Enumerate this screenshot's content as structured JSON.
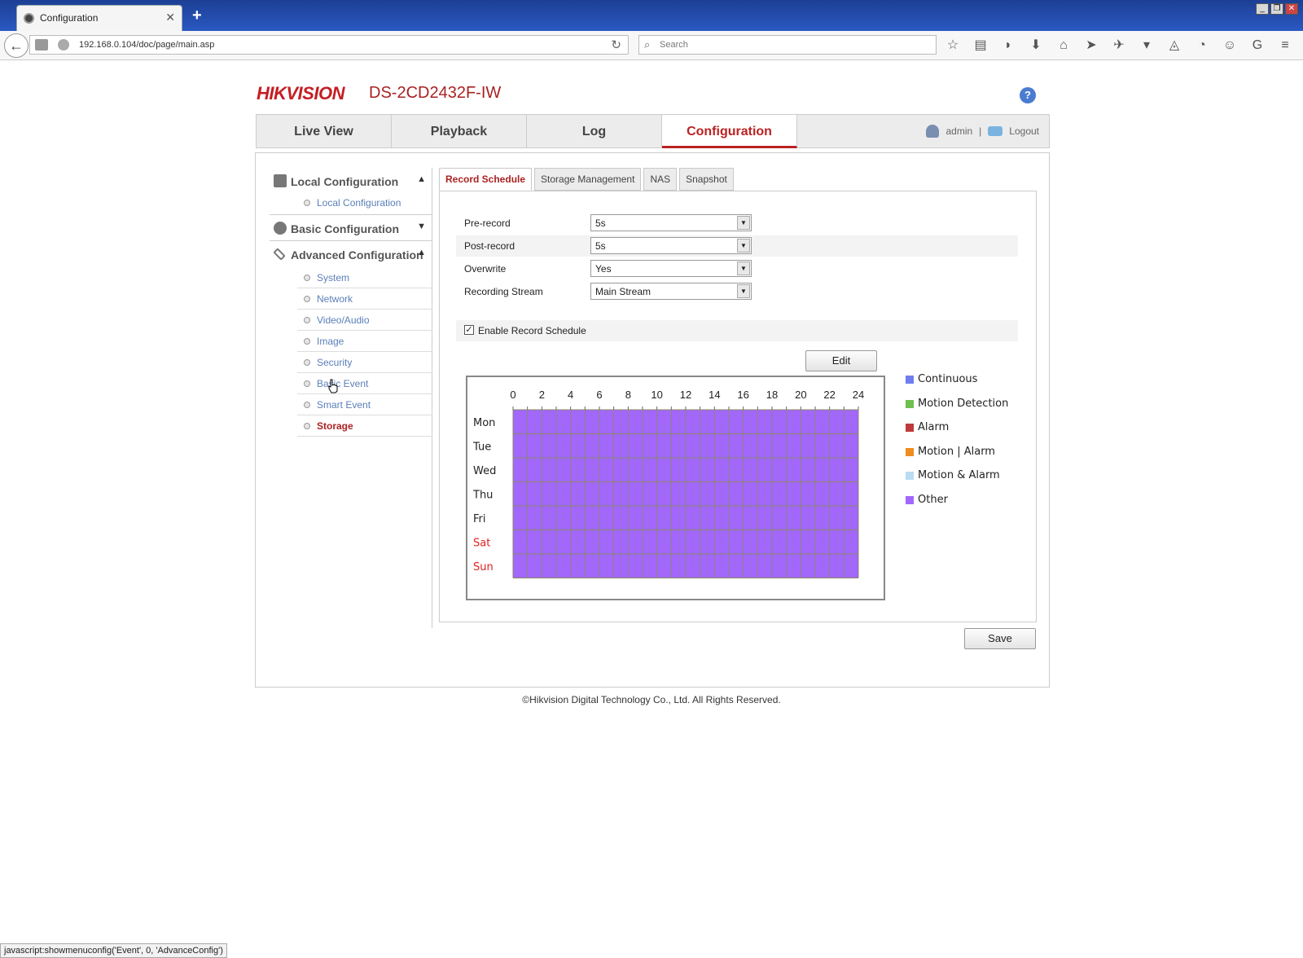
{
  "browser": {
    "tab_title": "Configuration",
    "new_tab_label": "+",
    "url": "192.168.0.104/doc/page/main.asp",
    "search_placeholder": "Search",
    "status_text": "javascript:showmenuconfig('Event', 0, 'AdvanceConfig')"
  },
  "header": {
    "brand": "HIKVISION",
    "model": "DS-2CD2432F-IW"
  },
  "topnav": {
    "tabs": [
      {
        "label": "Live View"
      },
      {
        "label": "Playback"
      },
      {
        "label": "Log"
      },
      {
        "label": "Configuration"
      }
    ],
    "active_tab": "Configuration",
    "user": "admin",
    "separator": "|",
    "logout": "Logout"
  },
  "sidebar": {
    "groups": [
      {
        "label": "Local Configuration",
        "expanded": true,
        "items": [
          "Local Configuration"
        ]
      },
      {
        "label": "Basic Configuration",
        "expanded": false,
        "items": []
      },
      {
        "label": "Advanced Configuration",
        "expanded": true,
        "items": [
          "System",
          "Network",
          "Video/Audio",
          "Image",
          "Security",
          "Basic Event",
          "Smart Event",
          "Storage"
        ]
      }
    ],
    "active_item": "Storage"
  },
  "subtabs": {
    "tabs": [
      "Record Schedule",
      "Storage Management",
      "NAS",
      "Snapshot"
    ],
    "active": "Record Schedule"
  },
  "form": {
    "pre_record": {
      "label": "Pre-record",
      "value": "5s"
    },
    "post_record": {
      "label": "Post-record",
      "value": "5s"
    },
    "overwrite": {
      "label": "Overwrite",
      "value": "Yes"
    },
    "recording_stream": {
      "label": "Recording Stream",
      "value": "Main Stream"
    },
    "enable_schedule": {
      "label": "Enable Record Schedule",
      "checked": true
    },
    "edit_label": "Edit",
    "save_label": "Save"
  },
  "schedule": {
    "hour_labels": [
      "0",
      "2",
      "4",
      "6",
      "8",
      "10",
      "12",
      "14",
      "16",
      "18",
      "20",
      "22",
      "24"
    ],
    "days": [
      {
        "label": "Mon",
        "weekend": false,
        "type": "Other",
        "start": 0,
        "end": 24
      },
      {
        "label": "Tue",
        "weekend": false,
        "type": "Other",
        "start": 0,
        "end": 24
      },
      {
        "label": "Wed",
        "weekend": false,
        "type": "Other",
        "start": 0,
        "end": 24
      },
      {
        "label": "Thu",
        "weekend": false,
        "type": "Other",
        "start": 0,
        "end": 24
      },
      {
        "label": "Fri",
        "weekend": false,
        "type": "Other",
        "start": 0,
        "end": 24
      },
      {
        "label": "Sat",
        "weekend": true,
        "type": "Other",
        "start": 0,
        "end": 24
      },
      {
        "label": "Sun",
        "weekend": true,
        "type": "Other",
        "start": 0,
        "end": 24
      }
    ],
    "weekend_color": "#e02020"
  },
  "legend": [
    {
      "label": "Continuous",
      "color": "#6f7df0"
    },
    {
      "label": "Motion Detection",
      "color": "#6fbf4f"
    },
    {
      "label": "Alarm",
      "color": "#c0393b"
    },
    {
      "label": "Motion | Alarm",
      "color": "#f08c1e"
    },
    {
      "label": "Motion & Alarm",
      "color": "#b9dcf2"
    },
    {
      "label": "Other",
      "color": "#a366ff"
    }
  ],
  "footer": "©Hikvision Digital Technology Co., Ltd. All Rights Reserved."
}
